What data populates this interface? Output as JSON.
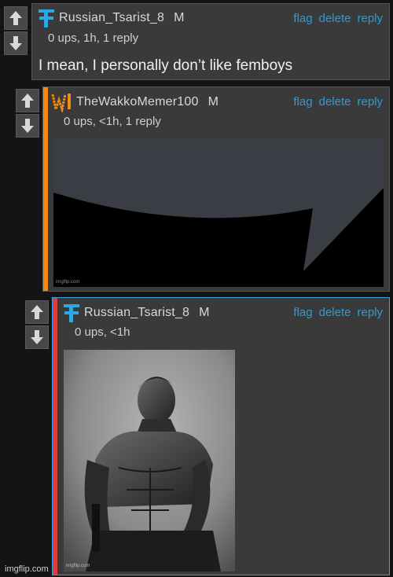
{
  "comments": [
    {
      "username": "Russian_Tsarist_8",
      "mod_badge": "M",
      "meta": "0 ups, 1h, 1 reply",
      "text": "I mean, I personally don’t like femboys",
      "actions": [
        "flag",
        "delete",
        "reply"
      ],
      "avatar": "tsarist-logo-icon"
    },
    {
      "username": "TheWakkoMemer100",
      "mod_badge": "M",
      "meta": "0 ups, <1h, 1 reply",
      "actions": [
        "flag",
        "delete",
        "reply"
      ],
      "avatar": "wakko-logo-icon",
      "stripe_color": "#f28c11",
      "image": {
        "desc": "speech bubble meme",
        "watermark": "imgflip.com"
      }
    },
    {
      "username": "Russian_Tsarist_8",
      "mod_badge": "M",
      "meta": "0 ups, <1h",
      "actions": [
        "flag",
        "delete",
        "reply"
      ],
      "avatar": "tsarist-logo-icon",
      "stripe_color": "#e03c3c",
      "image": {
        "desc": "gigachad photo",
        "watermark": "imgflip.com"
      }
    }
  ],
  "page_watermark": "imgflip.com",
  "colors": {
    "link": "#2f9bd7",
    "panel": "#3a3a3a",
    "bg": "#141414",
    "highlight_border": "#3ea3e0"
  }
}
